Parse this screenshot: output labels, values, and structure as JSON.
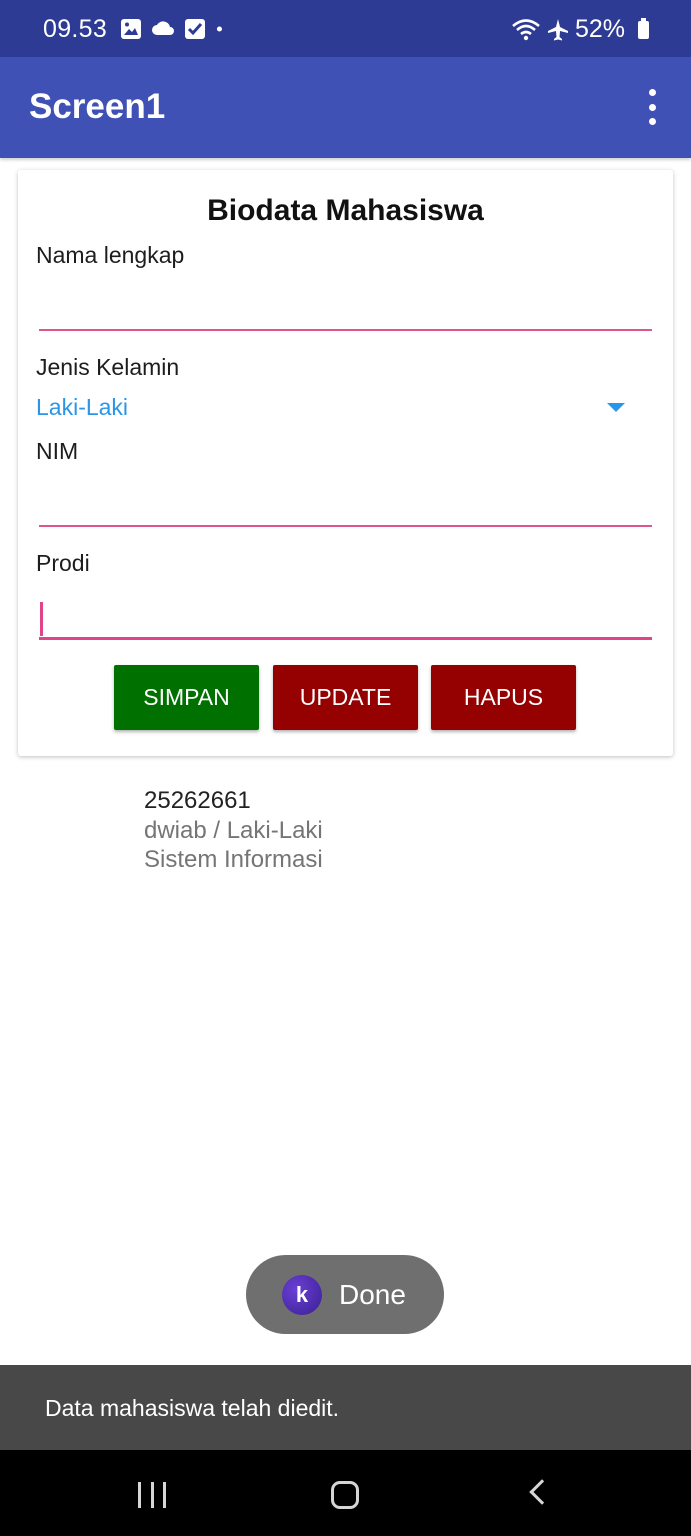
{
  "status_bar": {
    "time": "09.53",
    "battery": "52%",
    "icons": [
      "image-icon",
      "cloud-icon",
      "checkbox-icon",
      "dot-icon",
      "wifi-icon",
      "airplane-icon",
      "battery-icon"
    ]
  },
  "app_bar": {
    "title": "Screen1",
    "menu_icon": "more-vert-icon"
  },
  "form": {
    "title": "Biodata Mahasiswa",
    "name_label": "Nama lengkap",
    "name_value": "",
    "gender_label": "Jenis Kelamin",
    "gender_value": "Laki-Laki",
    "nim_label": "NIM",
    "nim_value": "",
    "prodi_label": "Prodi",
    "prodi_value": "",
    "buttons": {
      "save": "SIMPAN",
      "update": "UPDATE",
      "delete": "HAPUS"
    }
  },
  "list": {
    "items": [
      {
        "nim": "25262661",
        "name_gender": "dwiab / Laki-Laki",
        "prodi": "Sistem Informasi"
      }
    ]
  },
  "pill": {
    "icon_letter": "k",
    "label": "Done"
  },
  "snackbar": {
    "message": "Data mahasiswa telah diedit."
  },
  "colors": {
    "status_bar": "#2d3b95",
    "app_bar": "#3f51b5",
    "accent_underline": "#e0568c",
    "spinner_text": "#2b95e8",
    "save_button": "#007000",
    "update_button": "#950000",
    "delete_button": "#950000",
    "snackbar": "#484848"
  }
}
